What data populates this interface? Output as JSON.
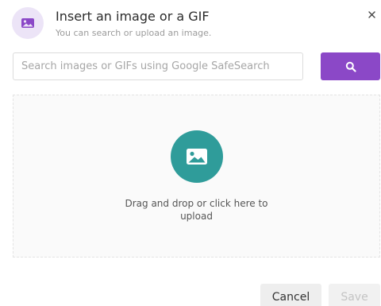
{
  "dialog": {
    "title": "Insert an image or a GIF",
    "subtitle": "You can search or upload an image.",
    "close_label": "×",
    "header_icon": "image-icon",
    "accent_color": "#8b48c7",
    "upload_color": "#2f9c9a"
  },
  "search": {
    "placeholder": "Search images or GIFs using Google SafeSearch",
    "value": "",
    "button_icon": "search-icon"
  },
  "dropzone": {
    "icon": "image-icon",
    "text": "Drag and drop or click here to upload"
  },
  "footer": {
    "cancel_label": "Cancel",
    "save_label": "Save"
  }
}
